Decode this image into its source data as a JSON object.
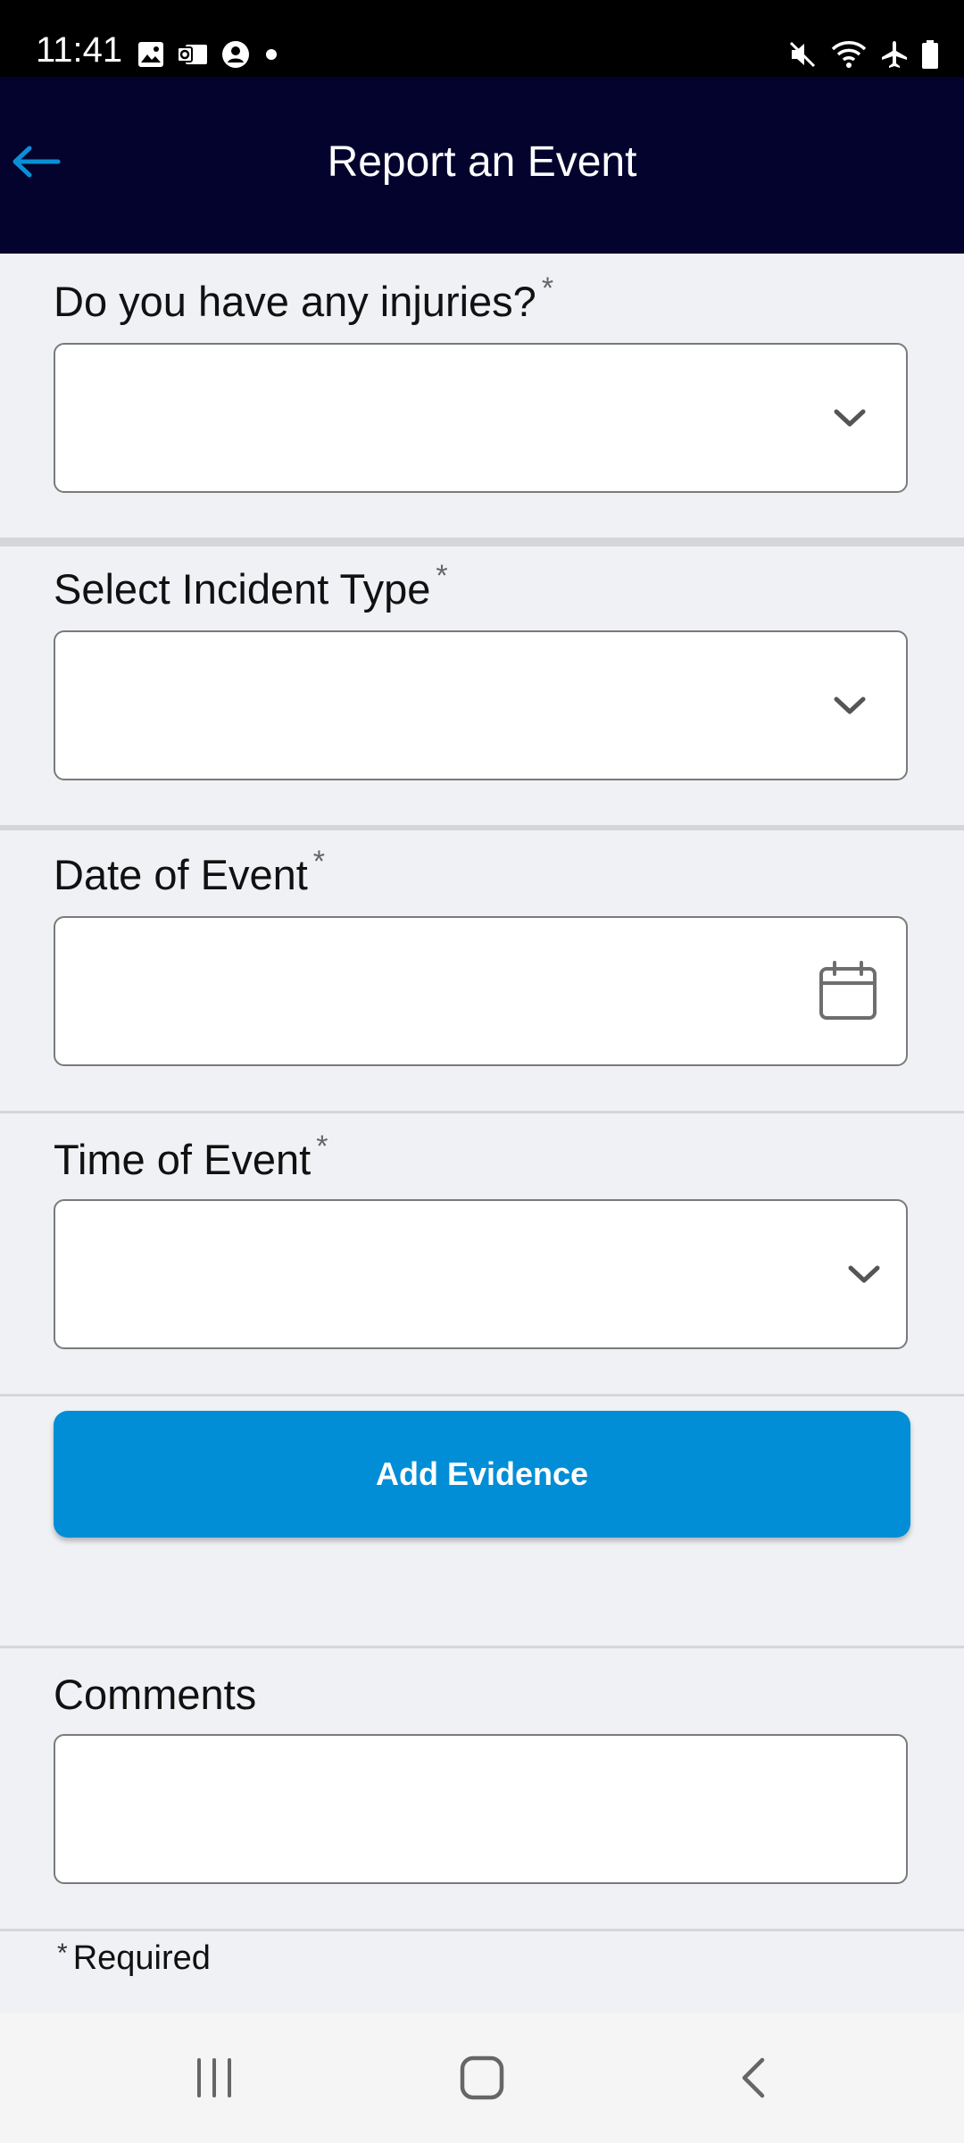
{
  "status_bar": {
    "time": "11:41",
    "left_icons": [
      "image-icon",
      "outlook-icon",
      "account-circle-icon",
      "dot-icon"
    ],
    "right_icons": [
      "mute-icon",
      "wifi-icon",
      "airplane-icon",
      "battery-icon"
    ]
  },
  "app_bar": {
    "title": "Report an Event",
    "back_icon": "arrow-left-icon",
    "accent_color": "#0a8fd6",
    "background_color": "#03032e"
  },
  "form": {
    "injuries": {
      "label": "Do you have any injuries?",
      "required_mark": "*",
      "value": "",
      "icon": "chevron-down-icon"
    },
    "incident_type": {
      "label": "Select Incident Type",
      "required_mark": "*",
      "value": "",
      "icon": "chevron-down-icon"
    },
    "date_of_event": {
      "label": "Date of Event",
      "required_mark": "*",
      "value": "",
      "icon": "calendar-icon"
    },
    "time_of_event": {
      "label": "Time of Event",
      "required_mark": "*",
      "value": "",
      "icon": "chevron-down-icon"
    },
    "add_evidence_label": "Add Evidence",
    "add_evidence_color": "#018ed6",
    "comments": {
      "label": "Comments",
      "value": ""
    },
    "required_note": {
      "star": "*",
      "text": "Required"
    }
  },
  "nav_bar": {
    "items": [
      "recents-icon",
      "home-icon",
      "back-icon"
    ]
  }
}
